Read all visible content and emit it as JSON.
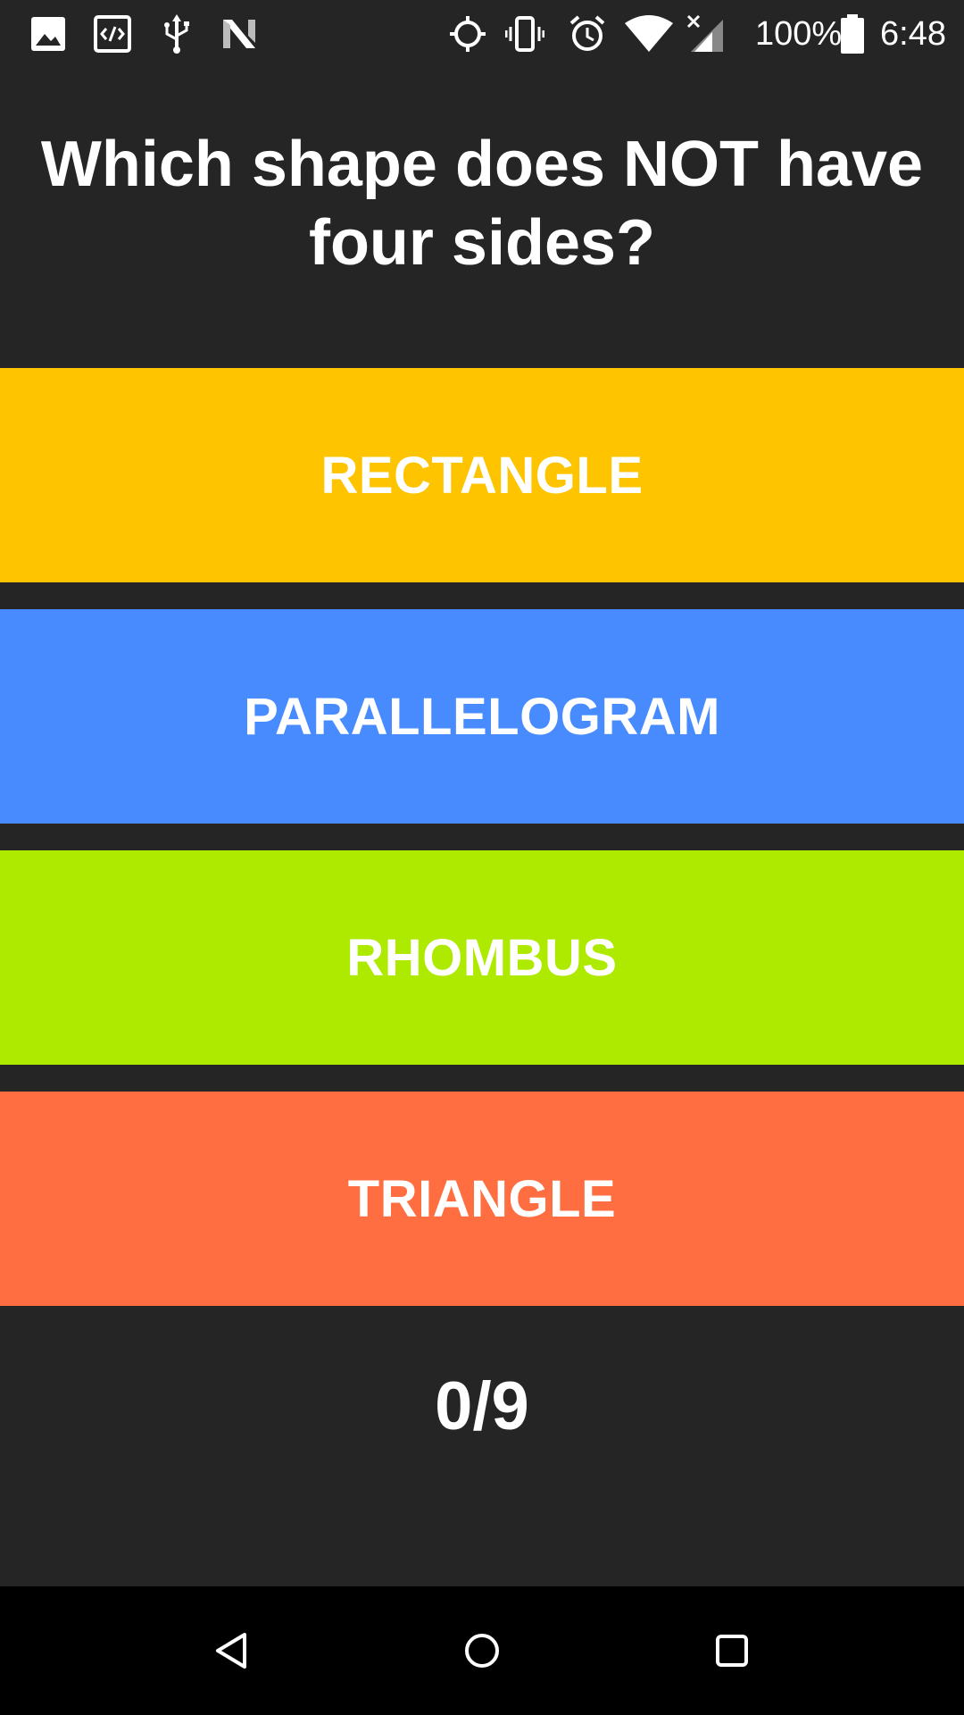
{
  "status_bar": {
    "left_icons": [
      "image-icon",
      "code-icon",
      "usb-icon",
      "n-icon"
    ],
    "right_icons": [
      "gps-icon",
      "vibrate-icon",
      "alarm-icon",
      "wifi-icon",
      "signal-off-icon",
      "battery-icon"
    ],
    "battery_text": "100%",
    "time": "6:48"
  },
  "question": {
    "text": "Which shape does NOT have four sides?"
  },
  "answers": [
    {
      "label": "RECTANGLE",
      "color": "#FFC400"
    },
    {
      "label": "PARALLELOGRAM",
      "color": "#478BFF"
    },
    {
      "label": "RHOMBUS",
      "color": "#AEEA00"
    },
    {
      "label": "TRIANGLE",
      "color": "#FF6E40"
    }
  ],
  "score": {
    "text": "0/9"
  },
  "nav_bar": {
    "buttons": [
      "back-icon",
      "home-icon",
      "recents-icon"
    ]
  }
}
